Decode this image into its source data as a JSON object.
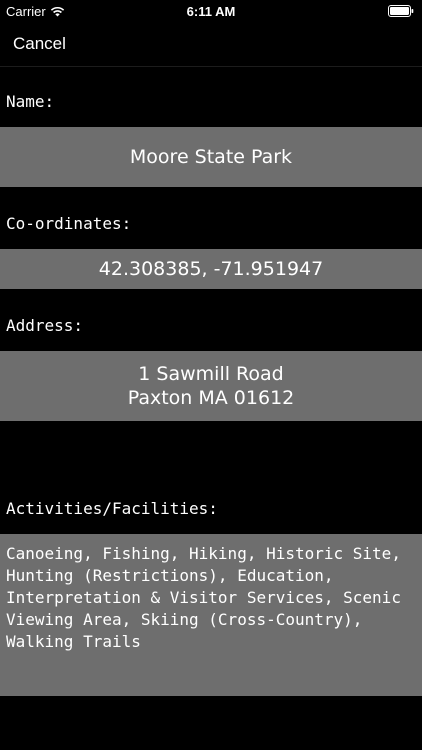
{
  "status_bar": {
    "carrier": "Carrier",
    "time": "6:11 AM",
    "wifi_icon": "wifi-icon",
    "battery_icon": "battery-icon"
  },
  "nav": {
    "cancel_label": "Cancel"
  },
  "form": {
    "name_label": "Name:",
    "name_value": "Moore State Park",
    "coordinates_label": "Co-ordinates:",
    "coordinates_value": "42.308385, -71.951947",
    "address_label": "Address:",
    "address_value": "1 Sawmill Road\nPaxton MA 01612",
    "activities_label": "Activities/Facilities:",
    "activities_value": "Canoeing, Fishing, Hiking, Historic Site, Hunting (Restrictions), Education, Interpretation & Visitor Services, Scenic Viewing Area, Skiing (Cross-Country), Walking Trails"
  },
  "colors": {
    "background": "#000000",
    "field_background": "#6e6e6e",
    "text": "#ffffff"
  }
}
